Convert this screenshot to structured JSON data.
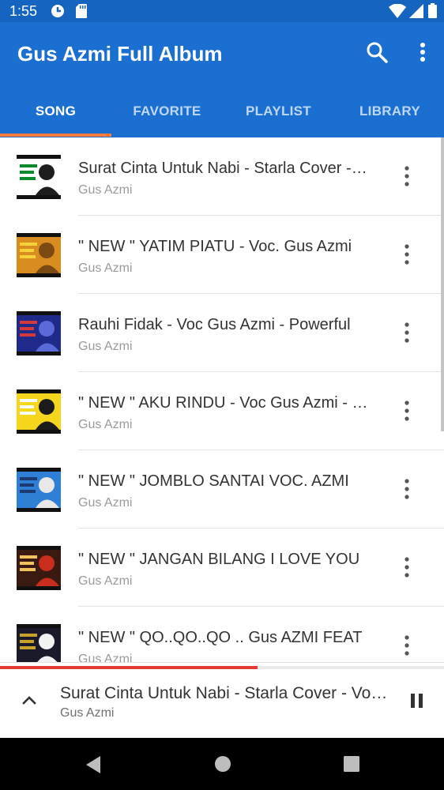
{
  "status_bar": {
    "time": "1:55",
    "icons": [
      "data-saver-icon",
      "sd-card-icon",
      "wifi-icon",
      "signal-icon",
      "battery-icon"
    ]
  },
  "app_bar": {
    "title": "Gus Azmi Full Album",
    "icons": [
      "search-icon",
      "more-vert-icon"
    ]
  },
  "tabs": [
    {
      "label": "SONG",
      "active": true
    },
    {
      "label": "FAVORITE",
      "active": false
    },
    {
      "label": "PLAYLIST",
      "active": false
    },
    {
      "label": "LIBRARY",
      "active": false
    }
  ],
  "songs": [
    {
      "title": "Surat Cinta Untuk Nabi - Starla Cover - Voc Gus Azmi",
      "artist": "Gus Azmi",
      "thumb_colors": [
        "#ffffff",
        "#1d1d1d",
        "#0a8a2a"
      ]
    },
    {
      "title": "\" NEW \" YATIM PIATU - Voc. Gus Azmi",
      "artist": "Gus Azmi",
      "thumb_colors": [
        "#d98c1f",
        "#7a4a12",
        "#f4d23a"
      ]
    },
    {
      "title": "Rauhi Fidak - Voc Gus Azmi - Powerful",
      "artist": "Gus Azmi",
      "thumb_colors": [
        "#1f2a8a",
        "#5a6ad8",
        "#d43a3a"
      ]
    },
    {
      "title": "\" NEW \" AKU RINDU - Voc Gus Azmi - Syubbanul Muslimin",
      "artist": "Gus Azmi",
      "thumb_colors": [
        "#f6d61c",
        "#1b1b1b",
        "#ffffff"
      ]
    },
    {
      "title": "\" NEW \" JOMBLO SANTAI VOC. AZMI",
      "artist": "Gus Azmi",
      "thumb_colors": [
        "#2f7fd6",
        "#e8e8e8",
        "#1d3a72"
      ]
    },
    {
      "title": "\" NEW \" JANGAN BILANG I LOVE YOU",
      "artist": "Gus Azmi",
      "thumb_colors": [
        "#3a1a10",
        "#c82d1e",
        "#f0c25a"
      ]
    },
    {
      "title": "\" NEW \"  QO..QO..QO .. Gus AZMI FEAT",
      "artist": "Gus Azmi",
      "thumb_colors": [
        "#1a1a2a",
        "#f2f2f2",
        "#c8a22a"
      ]
    }
  ],
  "now_playing": {
    "title": "Surat Cinta Untuk Nabi - Starla Cover - Voc Gus Azmi",
    "artist": "Gus Azmi",
    "progress": 0.58,
    "icons": [
      "chevron-up-icon",
      "pause-icon"
    ]
  },
  "nav_bar": {
    "icons": [
      "back-icon",
      "home-icon",
      "recents-icon"
    ]
  },
  "colors": {
    "primary": "#1a6fd0",
    "status_bar": "#1565c0",
    "tab_indicator": "#ff7a3d",
    "progress": "#e53935"
  }
}
